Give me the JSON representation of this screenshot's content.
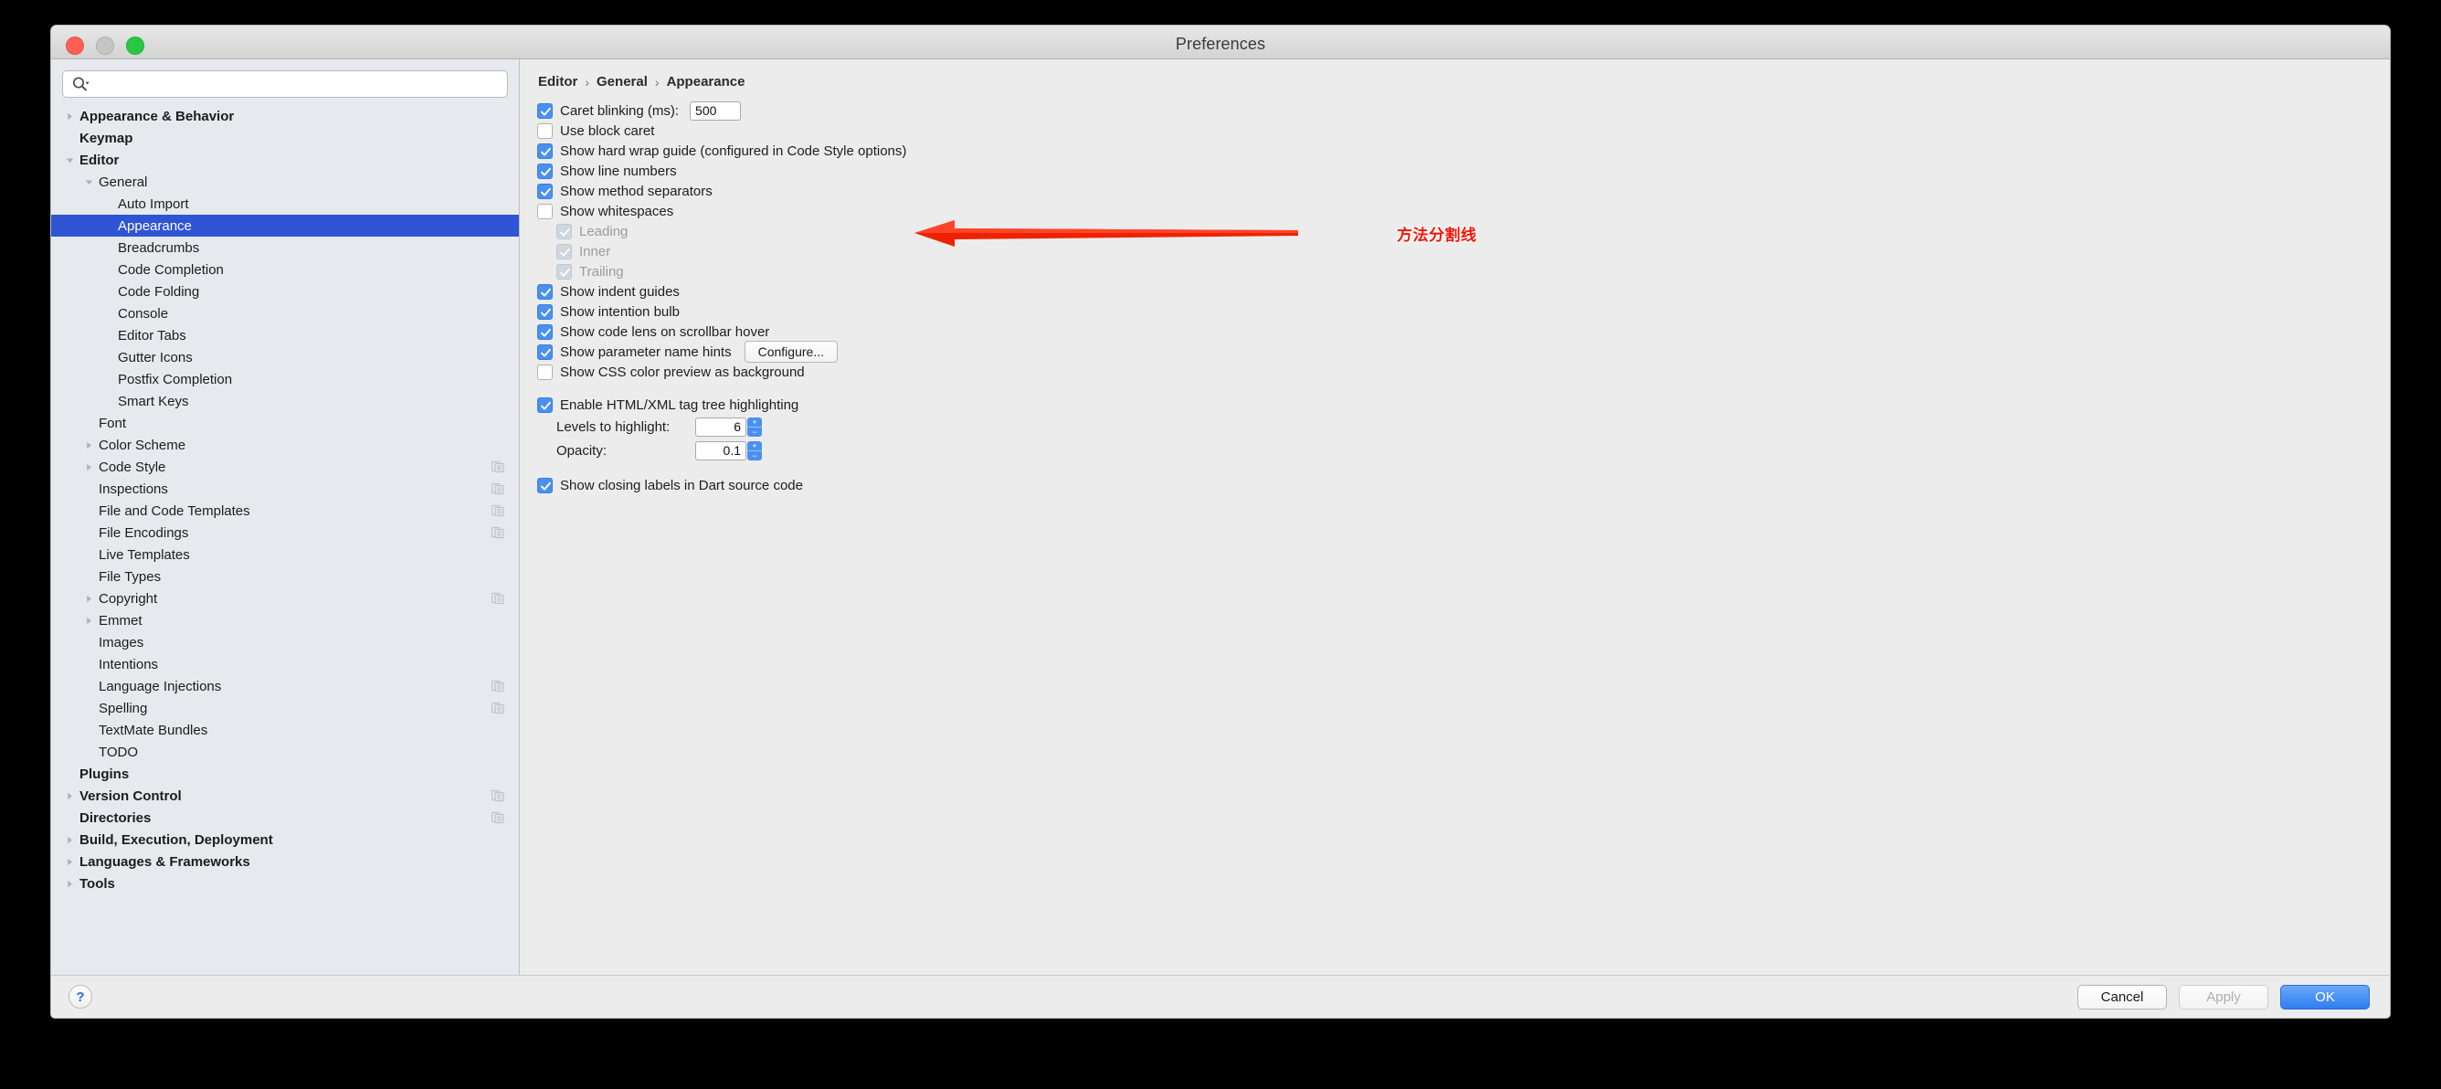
{
  "window": {
    "title": "Preferences",
    "traffic_lights": [
      "close-red",
      "minimize-gray",
      "zoom-green"
    ]
  },
  "sidebar": {
    "search": {
      "value": "",
      "placeholder": ""
    },
    "items": [
      {
        "label": "Appearance & Behavior",
        "level": 0,
        "bold": true,
        "twisty": "collapsed",
        "selected": false,
        "copy": false
      },
      {
        "label": "Keymap",
        "level": 0,
        "bold": true,
        "twisty": "none",
        "selected": false,
        "copy": false
      },
      {
        "label": "Editor",
        "level": 0,
        "bold": true,
        "twisty": "expanded",
        "selected": false,
        "copy": false
      },
      {
        "label": "General",
        "level": 1,
        "bold": false,
        "twisty": "expanded",
        "selected": false,
        "copy": false
      },
      {
        "label": "Auto Import",
        "level": 2,
        "bold": false,
        "twisty": "none",
        "selected": false,
        "copy": false
      },
      {
        "label": "Appearance",
        "level": 2,
        "bold": false,
        "twisty": "none",
        "selected": true,
        "copy": false
      },
      {
        "label": "Breadcrumbs",
        "level": 2,
        "bold": false,
        "twisty": "none",
        "selected": false,
        "copy": false
      },
      {
        "label": "Code Completion",
        "level": 2,
        "bold": false,
        "twisty": "none",
        "selected": false,
        "copy": false
      },
      {
        "label": "Code Folding",
        "level": 2,
        "bold": false,
        "twisty": "none",
        "selected": false,
        "copy": false
      },
      {
        "label": "Console",
        "level": 2,
        "bold": false,
        "twisty": "none",
        "selected": false,
        "copy": false
      },
      {
        "label": "Editor Tabs",
        "level": 2,
        "bold": false,
        "twisty": "none",
        "selected": false,
        "copy": false
      },
      {
        "label": "Gutter Icons",
        "level": 2,
        "bold": false,
        "twisty": "none",
        "selected": false,
        "copy": false
      },
      {
        "label": "Postfix Completion",
        "level": 2,
        "bold": false,
        "twisty": "none",
        "selected": false,
        "copy": false
      },
      {
        "label": "Smart Keys",
        "level": 2,
        "bold": false,
        "twisty": "none",
        "selected": false,
        "copy": false
      },
      {
        "label": "Font",
        "level": 1,
        "bold": false,
        "twisty": "none",
        "selected": false,
        "copy": false
      },
      {
        "label": "Color Scheme",
        "level": 1,
        "bold": false,
        "twisty": "collapsed",
        "selected": false,
        "copy": false
      },
      {
        "label": "Code Style",
        "level": 1,
        "bold": false,
        "twisty": "collapsed",
        "selected": false,
        "copy": true
      },
      {
        "label": "Inspections",
        "level": 1,
        "bold": false,
        "twisty": "none",
        "selected": false,
        "copy": true
      },
      {
        "label": "File and Code Templates",
        "level": 1,
        "bold": false,
        "twisty": "none",
        "selected": false,
        "copy": true
      },
      {
        "label": "File Encodings",
        "level": 1,
        "bold": false,
        "twisty": "none",
        "selected": false,
        "copy": true
      },
      {
        "label": "Live Templates",
        "level": 1,
        "bold": false,
        "twisty": "none",
        "selected": false,
        "copy": false
      },
      {
        "label": "File Types",
        "level": 1,
        "bold": false,
        "twisty": "none",
        "selected": false,
        "copy": false
      },
      {
        "label": "Copyright",
        "level": 1,
        "bold": false,
        "twisty": "collapsed",
        "selected": false,
        "copy": true
      },
      {
        "label": "Emmet",
        "level": 1,
        "bold": false,
        "twisty": "collapsed",
        "selected": false,
        "copy": false
      },
      {
        "label": "Images",
        "level": 1,
        "bold": false,
        "twisty": "none",
        "selected": false,
        "copy": false
      },
      {
        "label": "Intentions",
        "level": 1,
        "bold": false,
        "twisty": "none",
        "selected": false,
        "copy": false
      },
      {
        "label": "Language Injections",
        "level": 1,
        "bold": false,
        "twisty": "none",
        "selected": false,
        "copy": true
      },
      {
        "label": "Spelling",
        "level": 1,
        "bold": false,
        "twisty": "none",
        "selected": false,
        "copy": true
      },
      {
        "label": "TextMate Bundles",
        "level": 1,
        "bold": false,
        "twisty": "none",
        "selected": false,
        "copy": false
      },
      {
        "label": "TODO",
        "level": 1,
        "bold": false,
        "twisty": "none",
        "selected": false,
        "copy": false
      },
      {
        "label": "Plugins",
        "level": 0,
        "bold": true,
        "twisty": "none",
        "selected": false,
        "copy": false
      },
      {
        "label": "Version Control",
        "level": 0,
        "bold": true,
        "twisty": "collapsed",
        "selected": false,
        "copy": true
      },
      {
        "label": "Directories",
        "level": 0,
        "bold": true,
        "twisty": "none",
        "selected": false,
        "copy": true
      },
      {
        "label": "Build, Execution, Deployment",
        "level": 0,
        "bold": true,
        "twisty": "collapsed",
        "selected": false,
        "copy": false
      },
      {
        "label": "Languages & Frameworks",
        "level": 0,
        "bold": true,
        "twisty": "collapsed",
        "selected": false,
        "copy": false
      },
      {
        "label": "Tools",
        "level": 0,
        "bold": true,
        "twisty": "collapsed",
        "selected": false,
        "copy": false
      }
    ]
  },
  "main": {
    "breadcrumb": {
      "parts": [
        "Editor",
        "General",
        "Appearance"
      ],
      "separator": "›"
    },
    "options": [
      {
        "label": "Caret blinking (ms):",
        "state": "checked",
        "sub": false,
        "field": "500"
      },
      {
        "label": "Use block caret",
        "state": "unchecked",
        "sub": false
      },
      {
        "label": "Show hard wrap guide (configured in Code Style options)",
        "state": "checked",
        "sub": false
      },
      {
        "label": "Show line numbers",
        "state": "checked",
        "sub": false
      },
      {
        "label": "Show method separators",
        "state": "checked",
        "sub": false
      },
      {
        "label": "Show whitespaces",
        "state": "unchecked",
        "sub": false
      },
      {
        "label": "Leading",
        "state": "checked-disabled",
        "sub": true
      },
      {
        "label": "Inner",
        "state": "checked-disabled",
        "sub": true
      },
      {
        "label": "Trailing",
        "state": "checked-disabled",
        "sub": true
      },
      {
        "label": "Show indent guides",
        "state": "checked",
        "sub": false
      },
      {
        "label": "Show intention bulb",
        "state": "checked",
        "sub": false
      },
      {
        "label": "Show code lens on scrollbar hover",
        "state": "checked",
        "sub": false
      },
      {
        "label": "Show parameter name hints",
        "state": "checked",
        "sub": false,
        "button": "Configure..."
      },
      {
        "label": "Show CSS color preview as background",
        "state": "unchecked",
        "sub": false
      }
    ],
    "html_section": {
      "enable_label": "Enable HTML/XML tag tree highlighting",
      "enable_state": "checked",
      "levels_label": "Levels to highlight:",
      "levels_value": "6",
      "opacity_label": "Opacity:",
      "opacity_value": "0.1"
    },
    "dart_option": {
      "label": "Show closing labels in Dart source code",
      "state": "checked"
    }
  },
  "annotation": {
    "text": "方法分割线",
    "color": "#fb1200",
    "arrow": "left-arrow"
  },
  "footer": {
    "help_label": "?",
    "buttons": [
      {
        "label": "Cancel",
        "style": "normal"
      },
      {
        "label": "Apply",
        "style": "disabled"
      },
      {
        "label": "OK",
        "style": "primary"
      }
    ]
  },
  "colors": {
    "selection": "#2f55d4",
    "checkbox_on": "#4a90f0",
    "primary_button": "#2f7df0",
    "annotation_red": "#fb1200"
  }
}
